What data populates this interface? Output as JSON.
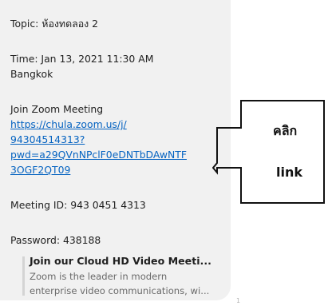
{
  "message": {
    "topic": "Topic: ห้องทดลอง 2",
    "time": "Time: Jan 13, 2021 11:30 AM",
    "timezone": "Bangkok",
    "join_label": "Join Zoom Meeting",
    "link_lines": [
      "https://chula.zoom.us/j/",
      "94304514313?",
      "pwd=a29QVnNPclF0eDNTbDAwNTF",
      "3OGF2QT09"
    ],
    "meeting_id": "Meeting ID: 943 0451 4313",
    "password": "Password: 438188"
  },
  "preview": {
    "title": "Join our Cloud HD Video Meeti...",
    "desc_line1": "Zoom is the leader in modern",
    "desc_line2": "enterprise video communications, wi..."
  },
  "seen_indicator": "1",
  "callout": {
    "line1": "คลิก",
    "line2": "link"
  },
  "colors": {
    "bubble": "#f1f1f1",
    "link": "#0563c1",
    "text": "#1f1f1f"
  }
}
